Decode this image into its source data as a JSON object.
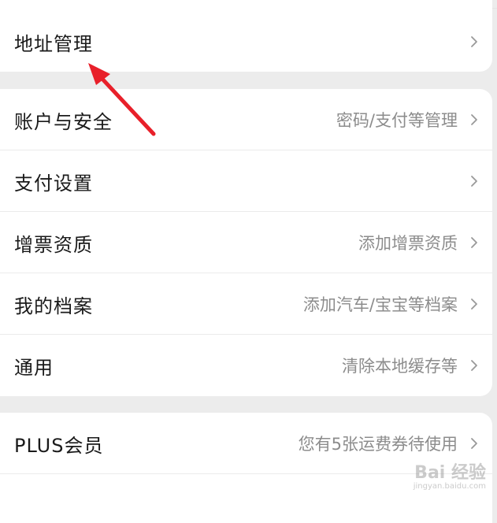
{
  "menu": {
    "address": {
      "label": "地址管理",
      "hint": ""
    },
    "items": [
      {
        "label": "账户与安全",
        "hint": "密码/支付等管理"
      },
      {
        "label": "支付设置",
        "hint": ""
      },
      {
        "label": "增票资质",
        "hint": "添加增票资质"
      },
      {
        "label": "我的档案",
        "hint": "添加汽车/宝宝等档案"
      },
      {
        "label": "通用",
        "hint": "清除本地缓存等"
      }
    ],
    "plus": {
      "label": "PLUS会员",
      "hint": "您有5张运费券待使用"
    }
  },
  "watermark": {
    "main": "Bai 经验",
    "sub": "jingyan.baidu.com"
  },
  "colors": {
    "background": "#ececec",
    "card": "#ffffff",
    "annotation_arrow": "#e8202a"
  },
  "icons": {
    "chevron": "chevron-right-icon",
    "annotation": "red-arrow-annotation"
  }
}
